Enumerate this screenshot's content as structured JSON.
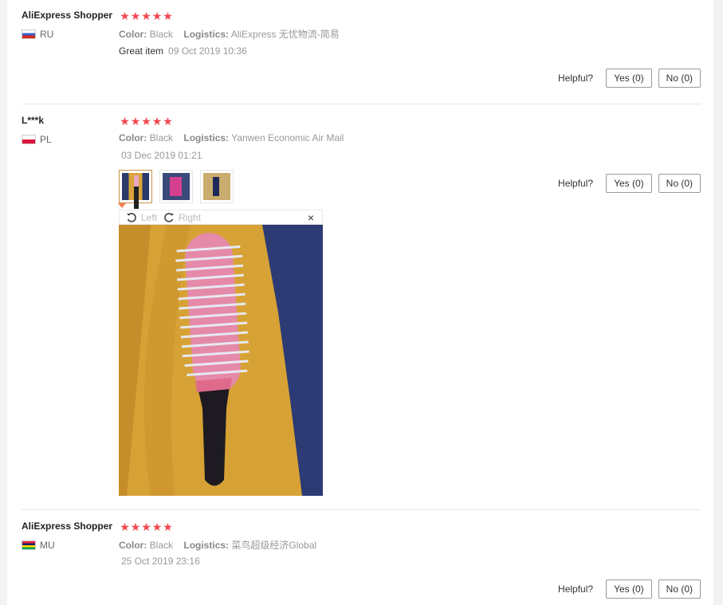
{
  "reviews": [
    {
      "name": "AliExpress Shopper",
      "country": "RU",
      "flag": "flag-ru",
      "stars": 5,
      "color_label": "Color:",
      "color_value": "Black",
      "logistics_label": "Logistics:",
      "logistics_value": "AliExpress 无忧物流-简易",
      "text": "Great item",
      "date": "09 Oct 2019 10:36",
      "helpful_label": "Helpful?",
      "yes_label": "Yes (0)",
      "no_label": "No (0)"
    },
    {
      "name": "L***k",
      "country": "PL",
      "flag": "flag-pl",
      "stars": 5,
      "color_label": "Color:",
      "color_value": "Black",
      "logistics_label": "Logistics:",
      "logistics_value": "Yanwen Economic Air Mail",
      "date": "03 Dec 2019 01:21",
      "helpful_label": "Helpful?",
      "yes_label": "Yes (0)",
      "no_label": "No (0)",
      "viewer": {
        "rotate_left_label": "Left",
        "rotate_right_label": "Right",
        "close_label": "×"
      }
    },
    {
      "name": "AliExpress Shopper",
      "country": "MU",
      "flag": "flag-mu",
      "stars": 5,
      "color_label": "Color:",
      "color_value": "Black",
      "logistics_label": "Logistics:",
      "logistics_value": "菜鸟超级经济Global",
      "date": "25 Oct 2019 23:16",
      "helpful_label": "Helpful?",
      "yes_label": "Yes (0)",
      "no_label": "No (0)"
    }
  ],
  "colors": {
    "star": "#f4464f",
    "active_thumb_border": "#c8934a"
  }
}
